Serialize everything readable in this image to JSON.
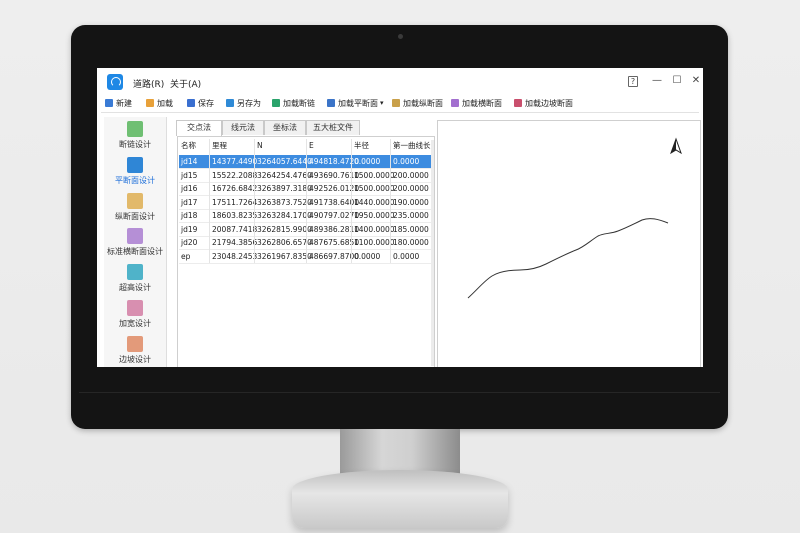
{
  "window": {
    "menu": [
      "道路(R)",
      "关于(A)"
    ]
  },
  "toolbar": {
    "buttons": [
      {
        "label": "新建",
        "icon": "new-file-icon",
        "color": "#3a7bd5"
      },
      {
        "label": "加载",
        "icon": "folder-icon",
        "color": "#e8a13a"
      },
      {
        "label": "保存",
        "icon": "save-icon",
        "color": "#3a6fd0"
      },
      {
        "label": "另存为",
        "icon": "save-as-icon",
        "color": "#2f8ad6"
      },
      {
        "label": "加载断链",
        "icon": "load-chain-icon",
        "color": "#2aa36b"
      },
      {
        "label": "加载平断面",
        "icon": "load-plan-icon",
        "color": "#3b74c8"
      },
      {
        "label": "加载纵断面",
        "icon": "load-profile-icon",
        "color": "#c9a04a"
      },
      {
        "label": "加载横断面",
        "icon": "load-cross-icon",
        "color": "#a26fcf"
      },
      {
        "label": "加载边坡断面",
        "icon": "load-slope-icon",
        "color": "#c94f6d"
      }
    ],
    "dropdown_glyph": "▾"
  },
  "sidebar": {
    "items": [
      {
        "label": "断链设计",
        "icon": "chain-design-icon",
        "color": "#6fbf73",
        "active": false
      },
      {
        "label": "平断面设计",
        "icon": "plan-design-icon",
        "color": "#2f86d6",
        "active": true
      },
      {
        "label": "纵断面设计",
        "icon": "profile-design-icon",
        "color": "#e2b96a",
        "active": false
      },
      {
        "label": "标准横断面设计",
        "icon": "cross-section-icon",
        "color": "#b58fd6",
        "active": false
      },
      {
        "label": "超高设计",
        "icon": "superelevation-icon",
        "color": "#4fb3c9",
        "active": false
      },
      {
        "label": "加宽设计",
        "icon": "widening-icon",
        "color": "#d88fb0",
        "active": false
      },
      {
        "label": "边坡设计",
        "icon": "slope-design-icon",
        "color": "#e39a7a",
        "active": false
      }
    ]
  },
  "tabs": [
    "交点法",
    "线元法",
    "坐标法",
    "五大桩文件"
  ],
  "table": {
    "columns": [
      "名称",
      "里程",
      "N",
      "E",
      "半径",
      "第一曲线长"
    ],
    "rows": [
      [
        "jd14",
        "14377.4490",
        "3264057.6440",
        "494818.4720",
        "0.0000",
        "0.0000"
      ],
      [
        "jd15",
        "15522.2088",
        "3264254.4760",
        "493690.7610",
        "1500.0000",
        "200.0000"
      ],
      [
        "jd16",
        "16726.6842",
        "3263897.3180",
        "492526.0120",
        "1500.0000",
        "200.0000"
      ],
      [
        "jd17",
        "17511.7264",
        "3263873.7520",
        "491738.6400",
        "1440.0000",
        "190.0000"
      ],
      [
        "jd18",
        "18603.8235",
        "3263284.1700",
        "490797.0270",
        "1950.0000",
        "235.0000"
      ],
      [
        "jd19",
        "20087.7418",
        "3262815.9900",
        "489386.2810",
        "1400.0000",
        "185.0000"
      ],
      [
        "jd20",
        "21794.3856",
        "3262806.6570",
        "487675.6850",
        "1100.0000",
        "180.0000"
      ],
      [
        "ep",
        "23048.2453",
        "3261967.8350",
        "486697.8700",
        "0.0000",
        "0.0000"
      ]
    ],
    "selected_row": 0,
    "selection_color": "#3d8ce0"
  },
  "plot": {
    "north_arrow_icon": "north-arrow-icon",
    "curve_color": "#333333"
  },
  "colors": {
    "accent": "#1e88e5"
  }
}
